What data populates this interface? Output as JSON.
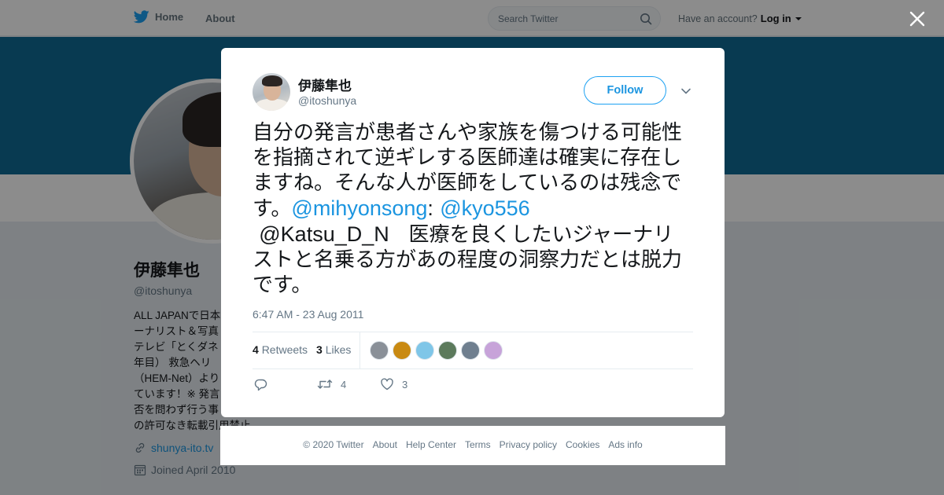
{
  "nav": {
    "home_label": "Home",
    "about_label": "About",
    "search_placeholder": "Search Twitter",
    "account_prompt": "Have an account?",
    "login_label": "Log in"
  },
  "profile": {
    "name": "伊藤隼也",
    "handle": "@itoshunya",
    "bio": "ALL JAPANで日本\nーナリスト＆写真\nテレビ「とくダネ\n年目） 救急ヘリ \n（HEM-Net）より\nています！※ 発言\n否を問わず行う事\nの許可なき転載引用禁止。",
    "link": "shunya-ito.tv",
    "joined": "Joined April 2010"
  },
  "tweet": {
    "author_name": "伊藤隼也",
    "author_handle": "@itoshunya",
    "follow_label": "Follow",
    "text_part1": "自分の発言が患者さんや家族を傷つける可能性を指摘されて逆ギレする医師達は確実に存在しますね。そんな人が医師をしているのは残念です。",
    "mention1": "@mihyonsong",
    "colon": ":",
    "mention2": "@kyo556",
    "mention3": "@Katsu_D_N",
    "text_part2": "医療を良くしたいジャーナリストと名乗る方があの程度の洞察力だとは脱力です。",
    "timestamp": "6:47 AM - 23 Aug 2011",
    "retweets_count": "4",
    "retweets_label": "Retweets",
    "likes_count": "3",
    "likes_label": "Likes",
    "action_retweet_count": "4",
    "action_like_count": "3"
  },
  "liker_colors": [
    "#8a9098",
    "#c98a12",
    "#7fc6e8",
    "#5c7a5c",
    "#6f7f8f",
    "#c7a3d9"
  ],
  "footer": {
    "copyright": "© 2020 Twitter",
    "about": "About",
    "help": "Help Center",
    "terms": "Terms",
    "privacy": "Privacy policy",
    "cookies": "Cookies",
    "ads": "Ads info"
  },
  "colors": {
    "accent": "#1da1f2",
    "link": "#1b95e0",
    "banner": "#0f6a94"
  }
}
